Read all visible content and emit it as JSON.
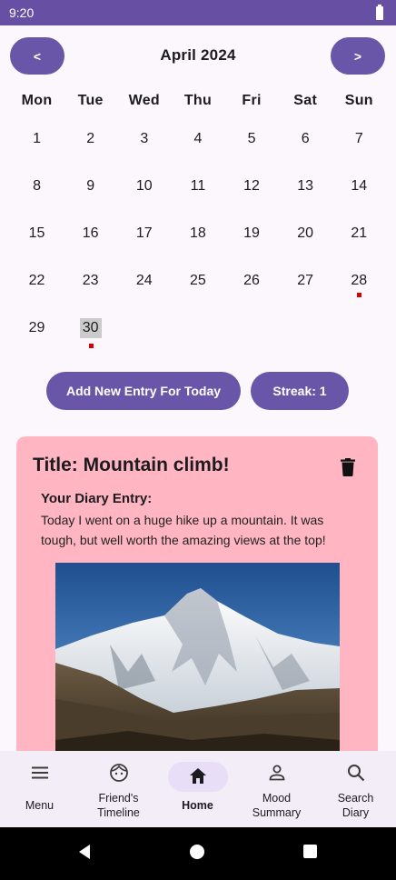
{
  "status_bar": {
    "time": "9:20"
  },
  "calendar": {
    "prev_label": "<",
    "next_label": ">",
    "month_title": "April 2024",
    "weekdays": [
      "Mon",
      "Tue",
      "Wed",
      "Thu",
      "Fri",
      "Sat",
      "Sun"
    ],
    "weeks": [
      [
        "1",
        "2",
        "3",
        "4",
        "5",
        "6",
        "7"
      ],
      [
        "8",
        "9",
        "10",
        "11",
        "12",
        "13",
        "14"
      ],
      [
        "15",
        "16",
        "17",
        "18",
        "19",
        "20",
        "21"
      ],
      [
        "22",
        "23",
        "24",
        "25",
        "26",
        "27",
        "28"
      ],
      [
        "29",
        "30",
        "",
        "",
        "",
        "",
        ""
      ]
    ],
    "selected_day": "30",
    "entry_marker_days": [
      "28",
      "30"
    ],
    "marker_color": "#d90000"
  },
  "actions": {
    "add_entry_label": "Add New Entry For Today",
    "streak_label": "Streak: 1"
  },
  "entry": {
    "title": "Title: Mountain climb!",
    "diary_label": "Your Diary Entry:",
    "diary_text": "Today I went on a huge hike up a mountain. It was tough, but well worth the amazing views at the top!",
    "photo": "snowy-mountain-photo",
    "card_color": "#ffb6c2"
  },
  "bottom_nav": {
    "items": [
      {
        "label": "Menu",
        "icon": "menu-icon"
      },
      {
        "label": "Friend's\nTimeline",
        "icon": "friends-face-icon"
      },
      {
        "label": "Home",
        "icon": "home-icon",
        "active": true
      },
      {
        "label": "Mood\nSummary",
        "icon": "person-icon"
      },
      {
        "label": "Search\nDiary",
        "icon": "search-icon"
      }
    ]
  },
  "theme": {
    "primary": "#6a56a8",
    "status_bar": "#6750a4",
    "nav_active_pill": "#e8def8"
  }
}
